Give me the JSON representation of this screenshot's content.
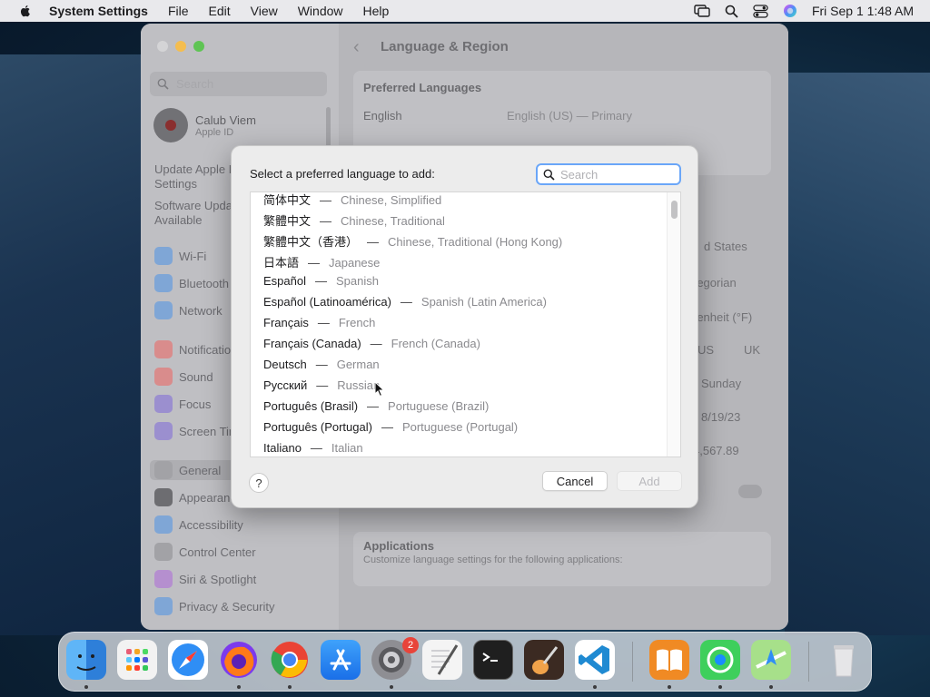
{
  "menubar": {
    "app_name": "System Settings",
    "items": [
      "File",
      "Edit",
      "View",
      "Window",
      "Help"
    ],
    "clock": "Fri Sep 1  1:48 AM"
  },
  "window": {
    "title": "Language & Region",
    "sidebar": {
      "search_placeholder": "Search",
      "user_name": "Calub Viem",
      "user_sub": "Apple ID",
      "update1": [
        "Update Apple ID",
        "Settings"
      ],
      "update2": [
        "Software Update",
        "Available"
      ],
      "items": [
        {
          "label": "Wi-Fi",
          "color": "#7fa6d6"
        },
        {
          "label": "Bluetooth",
          "color": "#7fa6d6"
        },
        {
          "label": "Network",
          "color": "#7fa6d6"
        },
        {
          "label": "Notifications",
          "color": "#d98c8c"
        },
        {
          "label": "Sound",
          "color": "#d98c8c"
        },
        {
          "label": "Focus",
          "color": "#9b8fcf"
        },
        {
          "label": "Screen Time",
          "color": "#9b8fcf"
        },
        {
          "label": "General",
          "color": "#a2a2a6"
        },
        {
          "label": "Appearance",
          "color": "#6d6d71"
        },
        {
          "label": "Accessibility",
          "color": "#7fa6d6"
        },
        {
          "label": "Control Center",
          "color": "#a2a2a6"
        },
        {
          "label": "Siri & Spotlight",
          "color": "#b58fcf"
        },
        {
          "label": "Privacy & Security",
          "color": "#7fa6d6"
        }
      ]
    },
    "content": {
      "preferred_languages": "Preferred Languages",
      "lang_english": "English",
      "lang_english_desc": "English (US) — Primary",
      "region": "d States",
      "calendar": "regorian",
      "temperature": "renheit (°F)",
      "measure_us": "US",
      "measure_uk": "UK",
      "first_day": "Sunday",
      "date_format": "8/19/23",
      "number_format": "4,567.89",
      "applications_title": "Applications",
      "applications_desc": "Customize language settings for the following applications:"
    }
  },
  "modal": {
    "prompt": "Select a preferred language to add:",
    "search_placeholder": "Search",
    "languages": [
      {
        "native": "简体中文",
        "english": "Chinese, Simplified"
      },
      {
        "native": "繁體中文",
        "english": "Chinese, Traditional"
      },
      {
        "native": "繁體中文（香港）",
        "english": "Chinese, Traditional (Hong Kong)"
      },
      {
        "native": "日本語",
        "english": "Japanese"
      },
      {
        "native": "Español",
        "english": "Spanish"
      },
      {
        "native": "Español (Latinoamérica)",
        "english": "Spanish (Latin America)"
      },
      {
        "native": "Français",
        "english": "French"
      },
      {
        "native": "Français (Canada)",
        "english": "French (Canada)"
      },
      {
        "native": "Deutsch",
        "english": "German"
      },
      {
        "native": "Русский",
        "english": "Russian"
      },
      {
        "native": "Português (Brasil)",
        "english": "Portuguese (Brazil)"
      },
      {
        "native": "Português (Portugal)",
        "english": "Portuguese (Portugal)"
      },
      {
        "native": "Italiano",
        "english": "Italian"
      }
    ],
    "separator": "—",
    "help_label": "?",
    "cancel_label": "Cancel",
    "add_label": "Add"
  },
  "dock": {
    "apps": [
      {
        "name": "Finder",
        "color": "#4aa3f0",
        "running": true
      },
      {
        "name": "Launchpad",
        "color": "#f2f2f2",
        "running": false
      },
      {
        "name": "Safari",
        "color": "#2f8ef5",
        "running": false
      },
      {
        "name": "Firefox",
        "color": "#7c3aed",
        "running": true
      },
      {
        "name": "Chrome",
        "color": "#ffffff",
        "running": true
      },
      {
        "name": "App Store",
        "color": "#2a8cf5",
        "running": false
      },
      {
        "name": "System Settings",
        "color": "#8e8e93",
        "running": true
      },
      {
        "name": "TextEdit",
        "color": "#f4f4f4",
        "running": false
      },
      {
        "name": "Terminal",
        "color": "#1f1f1f",
        "running": false
      },
      {
        "name": "GarageBand",
        "color": "#3b2a22",
        "running": false
      },
      {
        "name": "VS Code",
        "color": "#ffffff",
        "running": true
      },
      {
        "name": "Books",
        "color": "#f08a24",
        "running": true
      },
      {
        "name": "Find My",
        "color": "#3ecf5c",
        "running": true
      },
      {
        "name": "Maps",
        "color": "#a7e08a",
        "running": true
      },
      {
        "name": "Trash",
        "color": "#e6e6e8",
        "running": false
      }
    ],
    "settings_badge": "2"
  }
}
